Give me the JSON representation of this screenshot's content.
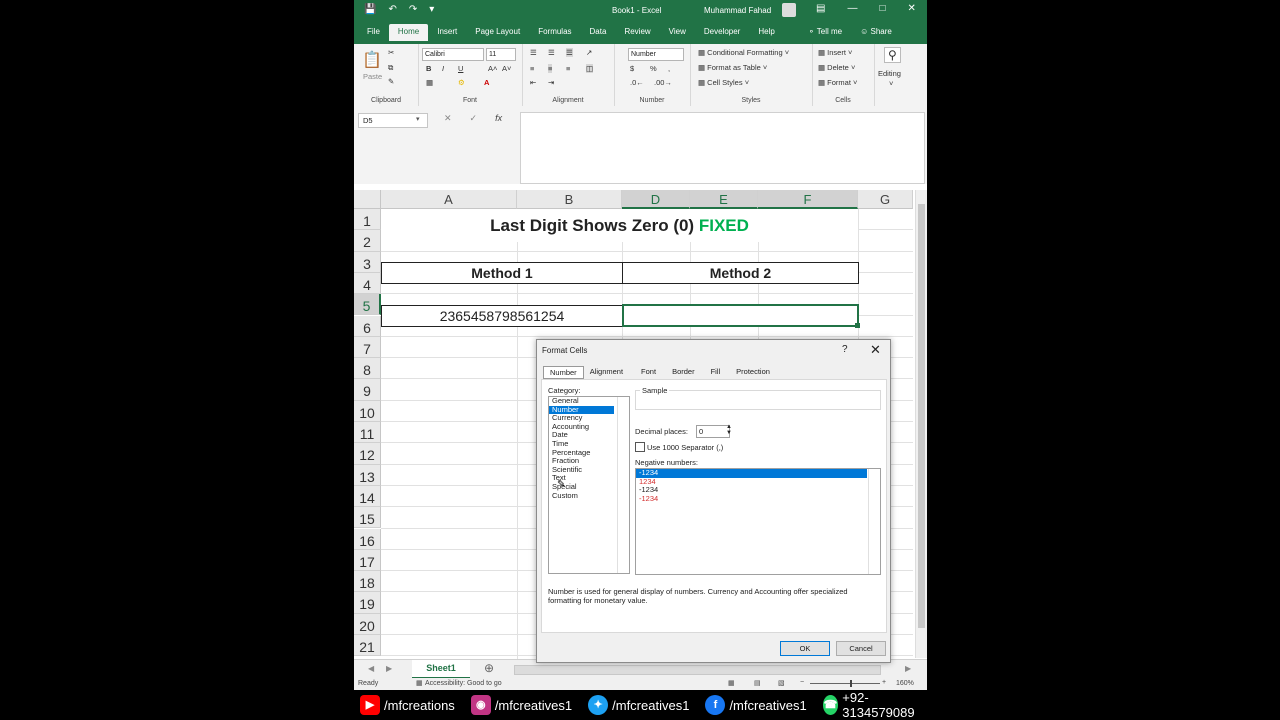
{
  "titlebar": {
    "title": "Book1  -  Excel",
    "user": "Muhammad Fahad"
  },
  "tabs": [
    "File",
    "Home",
    "Insert",
    "Page Layout",
    "Formulas",
    "Data",
    "Review",
    "View",
    "Developer",
    "Help"
  ],
  "tabs_right": {
    "tell_me": "Tell me",
    "share": "Share"
  },
  "ribbon": {
    "clipboard": {
      "label": "Clipboard",
      "paste": "Paste"
    },
    "font": {
      "label": "Font",
      "family": "Calibri",
      "size": "11",
      "bold": "B",
      "italic": "I",
      "underline": "U"
    },
    "alignment": {
      "label": "Alignment"
    },
    "number": {
      "label": "Number",
      "format": "Number"
    },
    "styles": {
      "label": "Styles",
      "conditional": "Conditional Formatting",
      "format_table": "Format as Table",
      "cell_styles": "Cell Styles"
    },
    "cells": {
      "label": "Cells",
      "insert": "Insert",
      "delete": "Delete",
      "format": "Format"
    },
    "editing": {
      "label": "Editing"
    }
  },
  "formula_bar": {
    "name_box": "D5",
    "fx": "fx",
    "value": ""
  },
  "columns": [
    "A",
    "B",
    "D",
    "E",
    "F",
    "G"
  ],
  "rows": [
    "1",
    "2",
    "3",
    "4",
    "5",
    "6",
    "7",
    "8",
    "9",
    "10",
    "11",
    "12",
    "13",
    "14",
    "15",
    "16",
    "17",
    "18",
    "19",
    "20",
    "21"
  ],
  "sheet": {
    "title_main": "Last Digit Shows Zero (0)",
    "title_fixed": "FIXED",
    "method1": "Method 1",
    "method2": "Method 2",
    "value_a5": "2365458798561254"
  },
  "sheet_tab": "Sheet1",
  "status": {
    "ready": "Ready",
    "accessibility": "Accessibility: Good to go",
    "zoom": "160%"
  },
  "dialog": {
    "title": "Format Cells",
    "help": "?",
    "close": "✕",
    "tabs": [
      "Number",
      "Alignment",
      "Font",
      "Border",
      "Fill",
      "Protection"
    ],
    "category_label": "Category:",
    "categories": [
      "General",
      "Number",
      "Currency",
      "Accounting",
      "Date",
      "Time",
      "Percentage",
      "Fraction",
      "Scientific",
      "Text",
      "Special",
      "Custom"
    ],
    "selected_category": "Number",
    "sample_label": "Sample",
    "decimal_label": "Decimal places:",
    "decimal_value": "0",
    "separator_label": "Use 1000 Separator (,)",
    "negative_label": "Negative numbers:",
    "negatives": [
      "-1234",
      "1234",
      "-1234",
      "-1234"
    ],
    "description": "Number is used for general display of numbers.  Currency and Accounting offer specialized formatting for monetary value.",
    "ok": "OK",
    "cancel": "Cancel"
  },
  "social": {
    "youtube": "/mfcreations",
    "instagram": "/mfcreatives1",
    "twitter": "/mfcreatives1",
    "facebook": "/mfcreatives1",
    "whatsapp": "+92-3134579089"
  },
  "colors": {
    "excel_green": "#217346",
    "fixed_green": "#00b050",
    "selection_blue": "#0078d7",
    "negative_red": "#d32f2f"
  }
}
